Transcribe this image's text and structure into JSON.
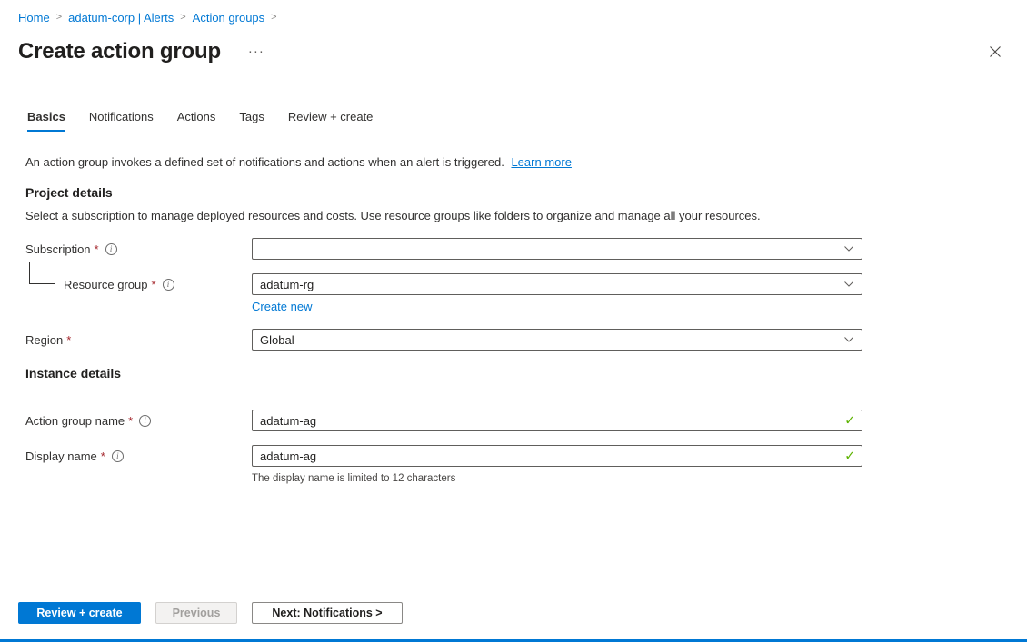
{
  "breadcrumb": {
    "items": [
      {
        "label": "Home"
      },
      {
        "label": "adatum-corp | Alerts"
      },
      {
        "label": "Action groups"
      }
    ]
  },
  "header": {
    "title": "Create action group"
  },
  "icons": {
    "more": "···",
    "info": "i",
    "check": "✓",
    "breadcrumb_separator": ">"
  },
  "tabs": {
    "basics": "Basics",
    "notifications": "Notifications",
    "actions": "Actions",
    "tags": "Tags",
    "review_create": "Review + create"
  },
  "intro": {
    "text": "An action group invokes a defined set of notifications and actions when an alert is triggered.",
    "learn_more_label": "Learn more"
  },
  "project_details": {
    "heading": "Project details",
    "description": "Select a subscription to manage deployed resources and costs. Use resource groups like folders to organize and manage all your resources.",
    "subscription": {
      "label": "Subscription",
      "required_marker": "*",
      "value": ""
    },
    "resource_group": {
      "label": "Resource group",
      "required_marker": "*",
      "value": "adatum-rg",
      "create_new_label": "Create new"
    },
    "region": {
      "label": "Region",
      "required_marker": "*",
      "value": "Global"
    }
  },
  "instance_details": {
    "heading": "Instance details",
    "action_group_name": {
      "label": "Action group name",
      "required_marker": "*",
      "value": "adatum-ag"
    },
    "display_name": {
      "label": "Display name",
      "required_marker": "*",
      "value": "adatum-ag",
      "helper_text": "The display name is limited to 12 characters"
    }
  },
  "footer": {
    "review_create_label": "Review + create",
    "previous_label": "Previous",
    "next_label": "Next: Notifications >"
  },
  "colors": {
    "accent": "#0078d4",
    "link": "#0078d4",
    "required_marker": "#a4262c",
    "valid_check": "#5db300"
  }
}
